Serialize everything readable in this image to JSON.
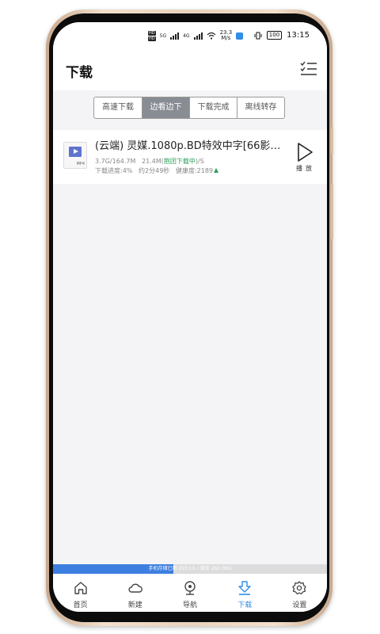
{
  "status_bar": {
    "left_badges": [
      "HD",
      "HD"
    ],
    "network_5g": "5G",
    "network_4g": "4G",
    "net_speed_value": "23.3",
    "net_speed_unit": "M/s",
    "battery": "100",
    "time": "13:15"
  },
  "header": {
    "title": "下载",
    "menu_icon": "checklist-icon"
  },
  "tabs": [
    {
      "label": "高速下载",
      "active": false
    },
    {
      "label": "边看边下",
      "active": true
    },
    {
      "label": "下载完成",
      "active": false
    },
    {
      "label": "离线转存",
      "active": false
    }
  ],
  "download_item": {
    "file_type": "MP4",
    "name": "(云端) 灵媒.1080p.BD特效中字[66影视...",
    "size": "3.7G/164.7M",
    "speed_prefix": "21.4M(",
    "speed_status": "抱团下载中",
    "speed_suffix": ")/S",
    "progress": "下载进度:4%",
    "progress_value": 0.04,
    "remaining": "约2分49秒",
    "health": "健康度:2189",
    "play_label": "播放"
  },
  "storage": {
    "text": "手机存储已用 203.1G / 剩余 260.06G",
    "used_fraction": 0.44
  },
  "bottom_nav": [
    {
      "label": "首页",
      "icon": "home-icon",
      "active": false
    },
    {
      "label": "新建",
      "icon": "cloud-icon",
      "active": false
    },
    {
      "label": "导航",
      "icon": "compass-icon",
      "active": false
    },
    {
      "label": "下载",
      "icon": "download-icon",
      "active": true
    },
    {
      "label": "设置",
      "icon": "gear-icon",
      "active": false
    }
  ],
  "colors": {
    "accent": "#2f8ee8",
    "active_tab": "#888c93",
    "health_green": "#2aa05a",
    "storage_fill": "#3d7fe0"
  }
}
